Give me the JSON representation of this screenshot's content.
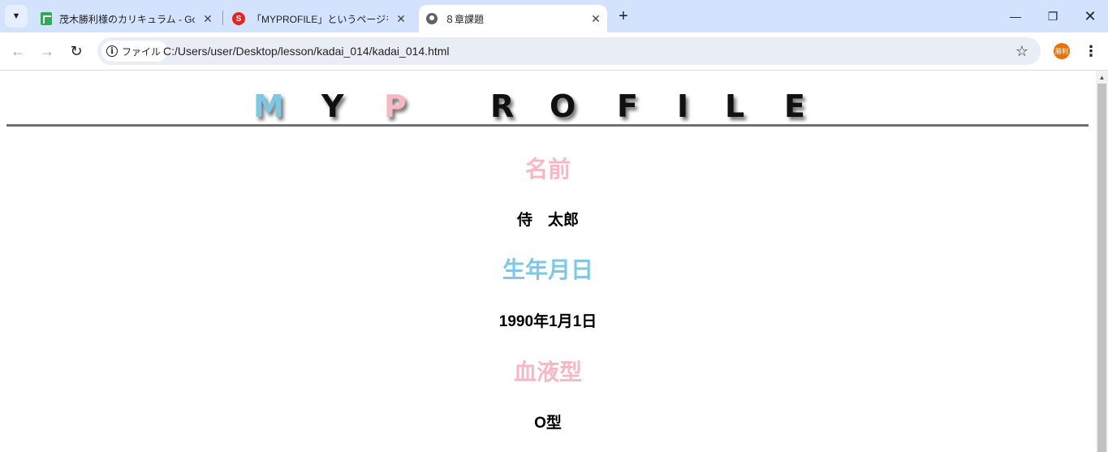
{
  "browser": {
    "tabs": [
      {
        "title": "茂木勝利様のカリキュラム - Googl",
        "favicon": "sheets-icon"
      },
      {
        "title": "「MYPROFILE」というページを作成し",
        "favicon": "samurai-icon"
      },
      {
        "title": "８章課題",
        "favicon": "globe-icon"
      }
    ],
    "address_chip": "ファイル",
    "url": "C:/Users/user/Desktop/lesson/kadai_014/kadai_014.html",
    "profile_initials": "勝利"
  },
  "page": {
    "logo_letters": [
      "M",
      "Y",
      "P",
      "R",
      "O",
      "F",
      "I",
      "L",
      "E"
    ],
    "sections": [
      {
        "heading": "名前",
        "value": "侍　太郎"
      },
      {
        "heading": "生年月日",
        "value": "1990年1月1日"
      },
      {
        "heading": "血液型",
        "value": "O型"
      }
    ]
  },
  "colors": {
    "pink": "#f7b8c4",
    "blue": "#7ec8e3",
    "divider": "#707070"
  }
}
